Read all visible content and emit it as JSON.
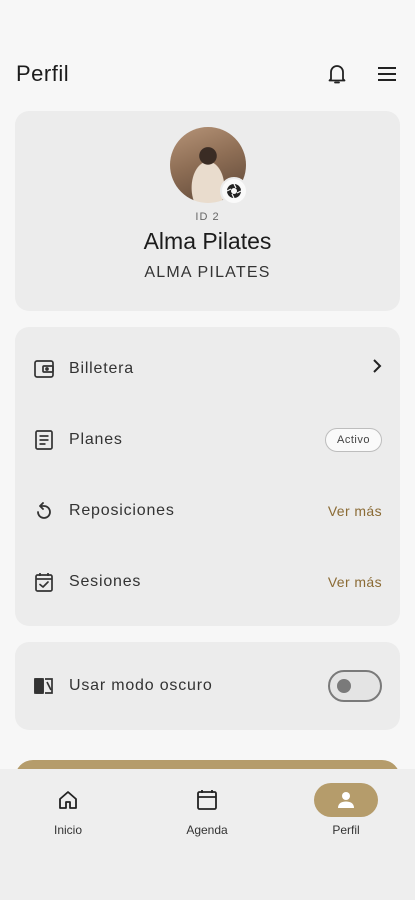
{
  "header": {
    "title": "Perfil"
  },
  "profile": {
    "id": "ID 2",
    "name": "Alma Pilates",
    "studio": "ALMA PILATES"
  },
  "menu": {
    "items": [
      {
        "label": "Billetera",
        "icon": "wallet-icon"
      },
      {
        "label": "Planes",
        "icon": "document-icon",
        "badge": "Activo"
      },
      {
        "label": "Reposiciones",
        "icon": "refresh-icon",
        "action": "Ver más"
      },
      {
        "label": "Sesiones",
        "icon": "calendar-check-icon",
        "action": "Ver más"
      }
    ]
  },
  "settings": {
    "dark_mode_label": "Usar modo oscuro",
    "dark_mode_on": false
  },
  "bottom_nav": {
    "items": [
      {
        "label": "Inicio",
        "icon": "home-icon",
        "active": false
      },
      {
        "label": "Agenda",
        "icon": "calendar-icon",
        "active": false
      },
      {
        "label": "Perfil",
        "icon": "person-icon",
        "active": true
      }
    ]
  },
  "colors": {
    "accent": "#b59c6b",
    "accent_text": "#8b6b35",
    "card": "#ececec",
    "background": "#f7f7f7"
  }
}
